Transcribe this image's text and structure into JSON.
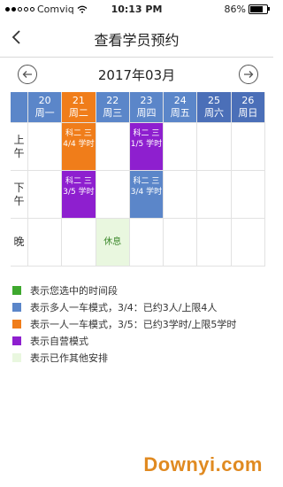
{
  "status": {
    "carrier": "Comviq",
    "time": "10:13 PM",
    "battery_text": "86%",
    "battery_level": 0.86
  },
  "nav": {
    "title": "查看学员预约"
  },
  "calendar": {
    "month": "2017年03月",
    "days": [
      {
        "date": "20",
        "weekday": "周一"
      },
      {
        "date": "21",
        "weekday": "周二"
      },
      {
        "date": "22",
        "weekday": "周三"
      },
      {
        "date": "23",
        "weekday": "周四"
      },
      {
        "date": "24",
        "weekday": "周五"
      },
      {
        "date": "25",
        "weekday": "周六"
      },
      {
        "date": "26",
        "weekday": "周日"
      }
    ],
    "periods": [
      {
        "label_line1": "上",
        "label_line2": "午"
      },
      {
        "label_line1": "下",
        "label_line2": "午"
      },
      {
        "label_line1": "晚",
        "label_line2": ""
      }
    ],
    "slots": {
      "morning_tue": {
        "line1": "科二 三",
        "line2": "4/4 学时"
      },
      "morning_thu": {
        "line1": "科二 三",
        "line2": "1/5 学时"
      },
      "afternoon_tue": {
        "line1": "科二 三",
        "line2": "3/5 学时"
      },
      "afternoon_thu": {
        "line1": "科二 三",
        "line2": "3/4 学时"
      },
      "evening_wed": {
        "text": "休息"
      }
    }
  },
  "legend": [
    {
      "color": "#3ea82e",
      "text": "表示您选中的时间段"
    },
    {
      "color": "#5b86c9",
      "text": "表示多人一车模式，3/4：已约3人/上限4人"
    },
    {
      "color": "#f07d1a",
      "text": "表示一人一车模式，3/5：已约3学时/上限5学时"
    },
    {
      "color": "#8e1fcf",
      "text": "表示自营模式"
    },
    {
      "color": "#e9f7df",
      "text": "表示已作其他安排"
    }
  ],
  "watermark": "Downyi.com"
}
